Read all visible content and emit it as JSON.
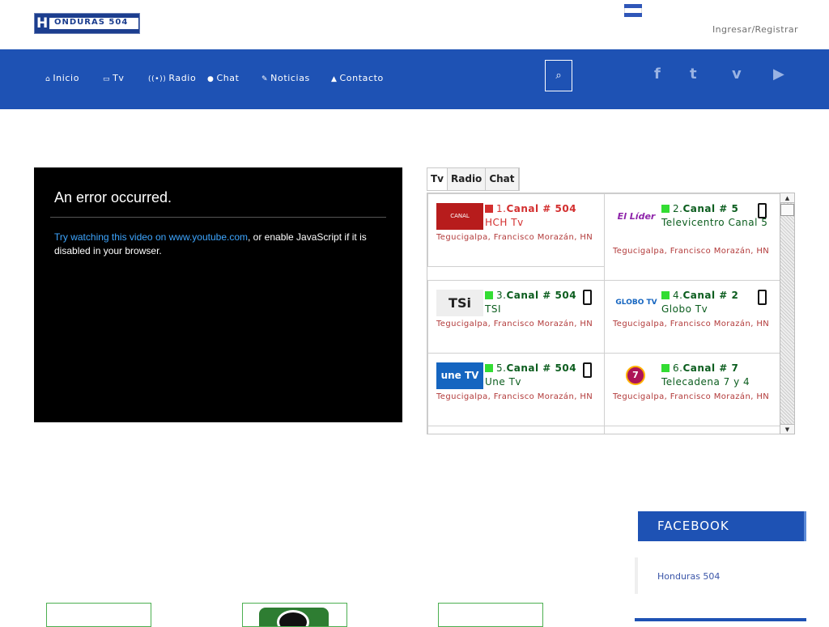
{
  "header": {
    "logo_text": "ONDURAS 504",
    "logo_letter": "H",
    "login_label": "Ingresar/Registrar",
    "flag_icon": "honduras-flag-icon"
  },
  "nav": {
    "items": [
      {
        "icon": "⌂",
        "label": "Inicio"
      },
      {
        "icon": "▭",
        "label": "Tv"
      },
      {
        "icon": "((•))",
        "label": "Radio"
      },
      {
        "icon": "●",
        "label": "Chat"
      },
      {
        "icon": "✎",
        "label": "Noticias"
      },
      {
        "icon": "▲",
        "label": "Contacto"
      }
    ],
    "search_icon": "⌕",
    "social": [
      "f",
      "t",
      "v",
      "▶"
    ],
    "accent": "#1e52b4"
  },
  "video": {
    "error_title": "An error occurred.",
    "link_text": "Try watching this video on www.youtube.com",
    "rest_text": ", or enable JavaScript if it is disabled in your browser."
  },
  "tabs": [
    "Tv",
    "Radio",
    "Chat"
  ],
  "channels": [
    {
      "num": "1.",
      "canal": "Canal # 504",
      "name": "HCH Tv",
      "location": "Tegucigalpa, Francisco Morazán, HN",
      "status": "offline",
      "status_color": "#d32f2f",
      "logo_text": "CANAL DESACTIVADO"
    },
    {
      "num": "2.",
      "canal": "Canal # 5",
      "name": "Televicentro Canal 5",
      "location": "Tegucigalpa, Francisco Morazán, HN",
      "status": "online",
      "status_color": "#33dd33",
      "logo_text": "El Líder"
    },
    {
      "num": "3.",
      "canal": "Canal # 504",
      "name": "TSI",
      "location": "Tegucigalpa, Francisco Morazán, HN",
      "status": "online",
      "status_color": "#33dd33",
      "logo_text": "TSi"
    },
    {
      "num": "4.",
      "canal": "Canal # 2",
      "name": "Globo Tv",
      "location": "Tegucigalpa, Francisco Morazán, HN",
      "status": "online",
      "status_color": "#33dd33",
      "logo_text": "GLOBO TV"
    },
    {
      "num": "5.",
      "canal": "Canal # 504",
      "name": "Une Tv",
      "location": "Tegucigalpa, Francisco Morazán, HN",
      "status": "online",
      "status_color": "#33dd33",
      "logo_text": "une TV"
    },
    {
      "num": "6.",
      "canal": "Canal # 7",
      "name": "Telecadena 7 y 4",
      "location": "Tegucigalpa, Francisco Morazán, HN",
      "status": "online",
      "status_color": "#33dd33",
      "logo_text": "7"
    }
  ],
  "sidebar": {
    "facebook_title": "FACEBOOK",
    "facebook_link": "Honduras 504"
  }
}
